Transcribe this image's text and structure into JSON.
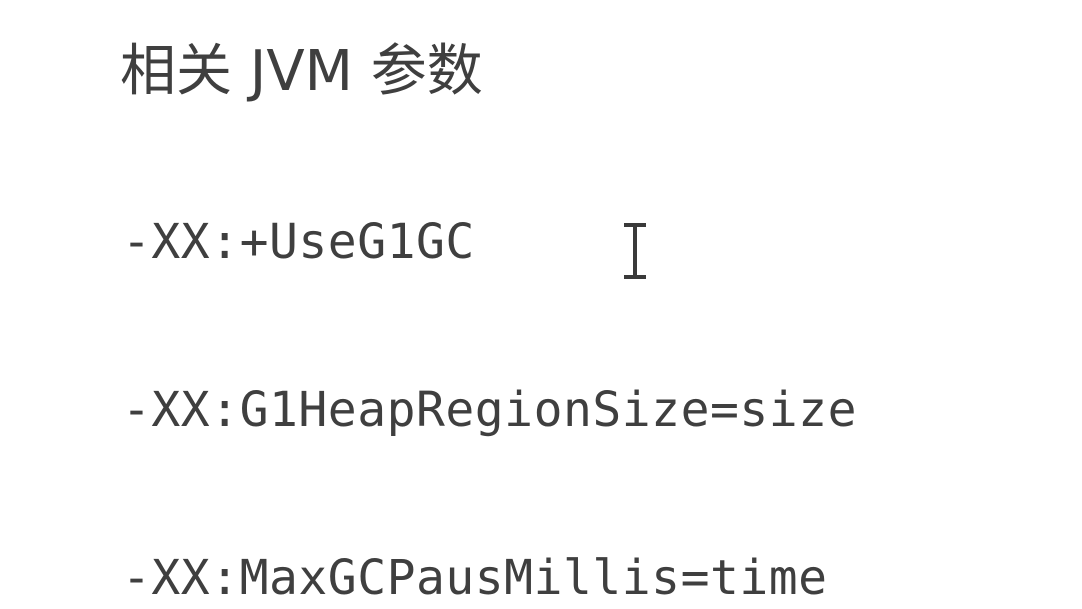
{
  "heading": "相关 JVM 参数",
  "params": [
    "-XX:+UseG1GC",
    "-XX:G1HeapRegionSize=size",
    "-XX:MaxGCPausMillis=time"
  ],
  "cursor": {
    "icon": "text-cursor-icon",
    "color": "#3a3a3a"
  }
}
